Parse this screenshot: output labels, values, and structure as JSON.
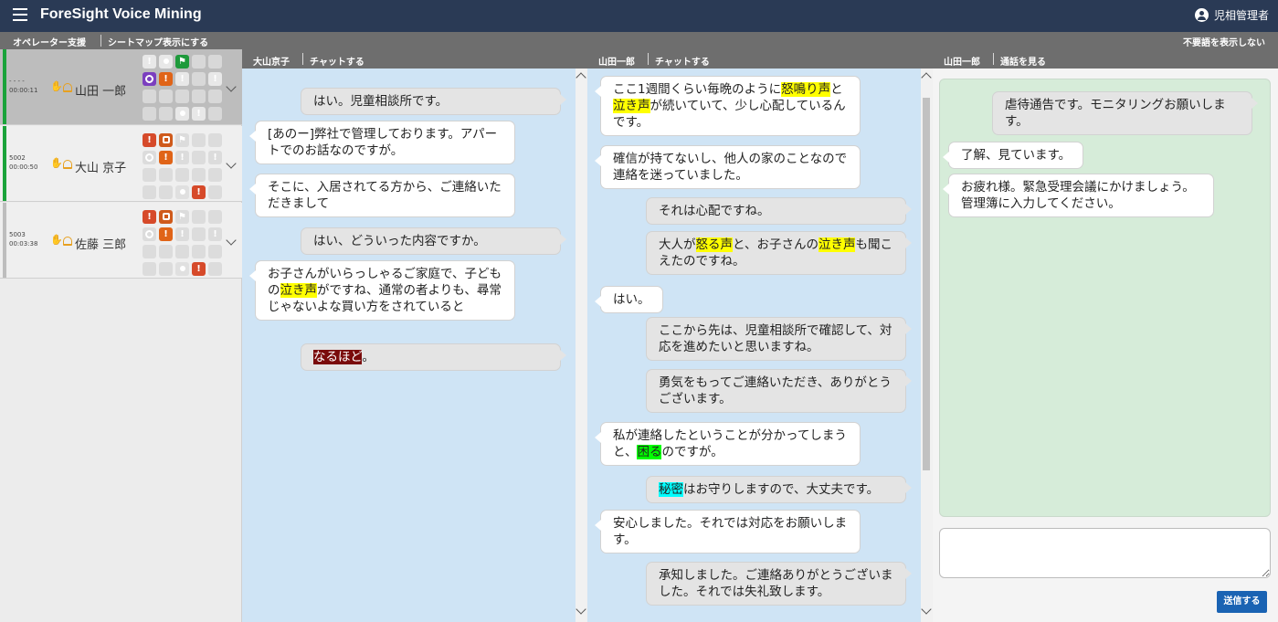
{
  "header": {
    "app_title": "ForeSight Voice Mining",
    "user_name": "児相管理者"
  },
  "subbar": {
    "operator_support": "オペレーター支援",
    "seatmap_toggle": "シートマップ表示にする",
    "hide_filler": "不要語を表示しない"
  },
  "operators": [
    {
      "ext": "- - - -",
      "time": "00:00:11",
      "name": "山田 一郎",
      "selected": true
    },
    {
      "ext": "5002",
      "time": "00:00:50",
      "name": "大山 京子",
      "selected": false
    },
    {
      "ext": "5003",
      "time": "00:03:38",
      "name": "佐藤 三郎",
      "selected": false
    }
  ],
  "panels": {
    "p1": {
      "name": "大山京子",
      "action": "チャットする"
    },
    "p2": {
      "name": "山田一郎",
      "action": "チャットする"
    },
    "p3": {
      "name": "山田一郎",
      "action": "通話を見る"
    }
  },
  "chat1": [
    {
      "side": "out",
      "text": "はい。児童相談所です。"
    },
    {
      "side": "in",
      "text": "[あのー]弊社で管理しております。アパートでのお話なのですが。"
    },
    {
      "side": "in",
      "text": "そこに、入居されてる方から、ご連絡いただきまして"
    },
    {
      "side": "out",
      "text": "はい、どういった内容ですか。"
    },
    {
      "side": "in",
      "pre": "お子さんがいらっしゃるご家庭で、子どもの",
      "hl": "泣き声",
      "post": "がですね、通常の者よりも、尋常じゃないよな買い方をされていると"
    },
    {
      "side": "out",
      "hl": "なるほど",
      "post": "。"
    }
  ],
  "chat2": [
    {
      "side": "in",
      "p1": "ここ1週間くらい毎晩のように",
      "h1": "怒鳴り声",
      "p2": "と",
      "h2": "泣き声",
      "p3": "が続いていて、少し心配しているんです。"
    },
    {
      "side": "in",
      "text": "確信が持てないし、他人の家のことなので連絡を迷っていました。"
    },
    {
      "side": "out",
      "text": "それは心配ですね。"
    },
    {
      "side": "out",
      "p1": "大人が",
      "h1": "怒る声",
      "p2": "と、お子さんの",
      "h2": "泣き声",
      "p3": "も聞こえたのですね。"
    },
    {
      "side": "in",
      "text": "はい。"
    },
    {
      "side": "out",
      "text": "ここから先は、児童相談所で確認して、対応を進めたいと思いますね。"
    },
    {
      "side": "out",
      "text": "勇気をもってご連絡いただき、ありがとうございます。"
    },
    {
      "side": "in",
      "p1": "私が連絡したということが分かってしまうと、",
      "h1": "困る",
      "p2": "のですが。"
    },
    {
      "side": "out",
      "h1": "秘密",
      "p2": "はお守りしますので、大丈夫です。"
    },
    {
      "side": "in",
      "text": "安心しました。それでは対応をお願いします。"
    },
    {
      "side": "out",
      "text": "承知しました。ご連絡ありがとうございました。それでは失礼致します。"
    }
  ],
  "chat3": [
    {
      "side": "out",
      "text": "虐待通告です。モニタリングお願いします。"
    },
    {
      "side": "in",
      "text": "了解、見ています。"
    },
    {
      "side": "in",
      "text": "お疲れ様。緊急受理会議にかけましょう。管理簿に入力してください。"
    }
  ],
  "reply": {
    "placeholder": "",
    "send_label": "送信する"
  },
  "colors": {
    "header": "#2a3a55",
    "subbar": "#6e6e6e",
    "chat_bg": "#cfe4f5",
    "supervisor_bg": "#d6ecd9",
    "send": "#1a63b3",
    "highlight_yellow": "#ffff00",
    "highlight_green": "#00ff00",
    "highlight_cyan": "#00ffff",
    "highlight_red": "#7a0b0b"
  }
}
